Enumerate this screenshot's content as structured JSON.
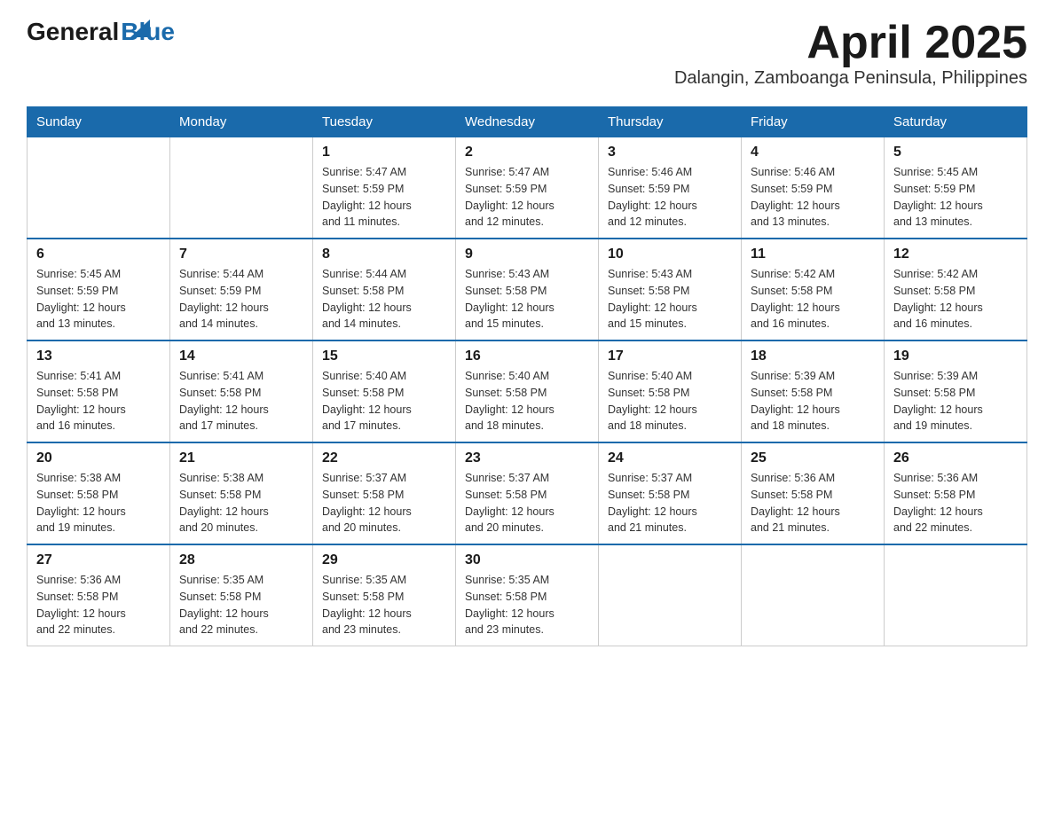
{
  "logo": {
    "general": "General",
    "blue": "Blue"
  },
  "title": "April 2025",
  "location": "Dalangin, Zamboanga Peninsula, Philippines",
  "weekdays": [
    "Sunday",
    "Monday",
    "Tuesday",
    "Wednesday",
    "Thursday",
    "Friday",
    "Saturday"
  ],
  "weeks": [
    [
      {
        "day": "",
        "info": ""
      },
      {
        "day": "",
        "info": ""
      },
      {
        "day": "1",
        "info": "Sunrise: 5:47 AM\nSunset: 5:59 PM\nDaylight: 12 hours\nand 11 minutes."
      },
      {
        "day": "2",
        "info": "Sunrise: 5:47 AM\nSunset: 5:59 PM\nDaylight: 12 hours\nand 12 minutes."
      },
      {
        "day": "3",
        "info": "Sunrise: 5:46 AM\nSunset: 5:59 PM\nDaylight: 12 hours\nand 12 minutes."
      },
      {
        "day": "4",
        "info": "Sunrise: 5:46 AM\nSunset: 5:59 PM\nDaylight: 12 hours\nand 13 minutes."
      },
      {
        "day": "5",
        "info": "Sunrise: 5:45 AM\nSunset: 5:59 PM\nDaylight: 12 hours\nand 13 minutes."
      }
    ],
    [
      {
        "day": "6",
        "info": "Sunrise: 5:45 AM\nSunset: 5:59 PM\nDaylight: 12 hours\nand 13 minutes."
      },
      {
        "day": "7",
        "info": "Sunrise: 5:44 AM\nSunset: 5:59 PM\nDaylight: 12 hours\nand 14 minutes."
      },
      {
        "day": "8",
        "info": "Sunrise: 5:44 AM\nSunset: 5:58 PM\nDaylight: 12 hours\nand 14 minutes."
      },
      {
        "day": "9",
        "info": "Sunrise: 5:43 AM\nSunset: 5:58 PM\nDaylight: 12 hours\nand 15 minutes."
      },
      {
        "day": "10",
        "info": "Sunrise: 5:43 AM\nSunset: 5:58 PM\nDaylight: 12 hours\nand 15 minutes."
      },
      {
        "day": "11",
        "info": "Sunrise: 5:42 AM\nSunset: 5:58 PM\nDaylight: 12 hours\nand 16 minutes."
      },
      {
        "day": "12",
        "info": "Sunrise: 5:42 AM\nSunset: 5:58 PM\nDaylight: 12 hours\nand 16 minutes."
      }
    ],
    [
      {
        "day": "13",
        "info": "Sunrise: 5:41 AM\nSunset: 5:58 PM\nDaylight: 12 hours\nand 16 minutes."
      },
      {
        "day": "14",
        "info": "Sunrise: 5:41 AM\nSunset: 5:58 PM\nDaylight: 12 hours\nand 17 minutes."
      },
      {
        "day": "15",
        "info": "Sunrise: 5:40 AM\nSunset: 5:58 PM\nDaylight: 12 hours\nand 17 minutes."
      },
      {
        "day": "16",
        "info": "Sunrise: 5:40 AM\nSunset: 5:58 PM\nDaylight: 12 hours\nand 18 minutes."
      },
      {
        "day": "17",
        "info": "Sunrise: 5:40 AM\nSunset: 5:58 PM\nDaylight: 12 hours\nand 18 minutes."
      },
      {
        "day": "18",
        "info": "Sunrise: 5:39 AM\nSunset: 5:58 PM\nDaylight: 12 hours\nand 18 minutes."
      },
      {
        "day": "19",
        "info": "Sunrise: 5:39 AM\nSunset: 5:58 PM\nDaylight: 12 hours\nand 19 minutes."
      }
    ],
    [
      {
        "day": "20",
        "info": "Sunrise: 5:38 AM\nSunset: 5:58 PM\nDaylight: 12 hours\nand 19 minutes."
      },
      {
        "day": "21",
        "info": "Sunrise: 5:38 AM\nSunset: 5:58 PM\nDaylight: 12 hours\nand 20 minutes."
      },
      {
        "day": "22",
        "info": "Sunrise: 5:37 AM\nSunset: 5:58 PM\nDaylight: 12 hours\nand 20 minutes."
      },
      {
        "day": "23",
        "info": "Sunrise: 5:37 AM\nSunset: 5:58 PM\nDaylight: 12 hours\nand 20 minutes."
      },
      {
        "day": "24",
        "info": "Sunrise: 5:37 AM\nSunset: 5:58 PM\nDaylight: 12 hours\nand 21 minutes."
      },
      {
        "day": "25",
        "info": "Sunrise: 5:36 AM\nSunset: 5:58 PM\nDaylight: 12 hours\nand 21 minutes."
      },
      {
        "day": "26",
        "info": "Sunrise: 5:36 AM\nSunset: 5:58 PM\nDaylight: 12 hours\nand 22 minutes."
      }
    ],
    [
      {
        "day": "27",
        "info": "Sunrise: 5:36 AM\nSunset: 5:58 PM\nDaylight: 12 hours\nand 22 minutes."
      },
      {
        "day": "28",
        "info": "Sunrise: 5:35 AM\nSunset: 5:58 PM\nDaylight: 12 hours\nand 22 minutes."
      },
      {
        "day": "29",
        "info": "Sunrise: 5:35 AM\nSunset: 5:58 PM\nDaylight: 12 hours\nand 23 minutes."
      },
      {
        "day": "30",
        "info": "Sunrise: 5:35 AM\nSunset: 5:58 PM\nDaylight: 12 hours\nand 23 minutes."
      },
      {
        "day": "",
        "info": ""
      },
      {
        "day": "",
        "info": ""
      },
      {
        "day": "",
        "info": ""
      }
    ]
  ]
}
